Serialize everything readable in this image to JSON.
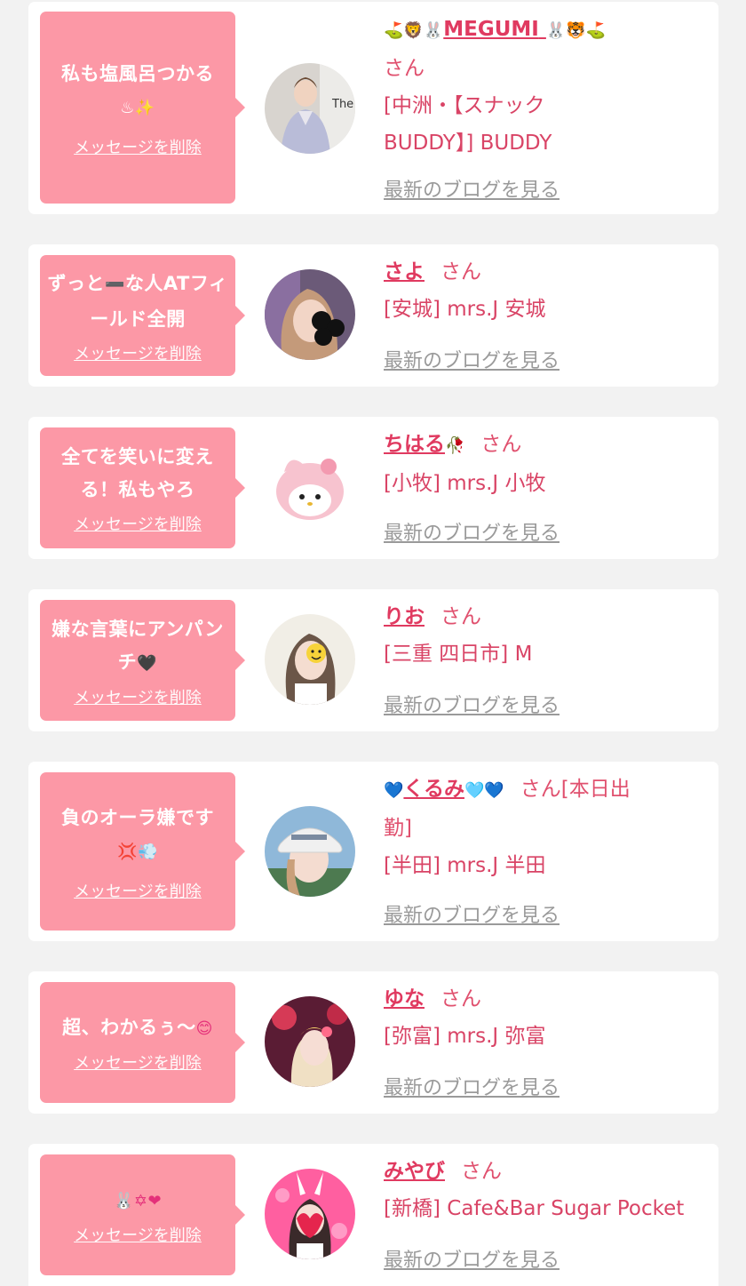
{
  "delete_label": "メッセージを削除",
  "blog_label": "最新のブログを見る",
  "san_label": "さん",
  "cards": [
    {
      "message": "私も塩風呂つかる",
      "message_emoji": "♨✨",
      "name": "MEGUMI",
      "name_prefix_emoji": "🐲🦁🐰",
      "name_suffix_emoji": "🐰🐯🐲",
      "shop_line1": "[中洲・【スナック",
      "shop_line2": "BUDDY】] BUDDY"
    },
    {
      "message": "ずっと",
      "message_mid_emoji": "➖",
      "message_tail": "な人ATフィールド全開",
      "name": "さよ",
      "shop_line1": "[安城] mrs.J 安城"
    },
    {
      "message": "全てを笑いに変える！私もやろ",
      "name": "ちはる",
      "name_suffix_emoji": "🥀",
      "shop_line1": "[小牧] mrs.J 小牧"
    },
    {
      "message": "嫌な言葉にアンパンチ",
      "message_emoji": "🖤",
      "name": "りお",
      "shop_line1": "[三重 四日市] M"
    },
    {
      "message": "負のオーラ嫌です",
      "message_emoji": "💢💨",
      "name": "くるみ",
      "name_prefix_emoji": "💙",
      "name_suffix_emoji": "🩵💙",
      "san_suffix": "[本日出",
      "name_line2": "勤]",
      "shop_line1": "[半田] mrs.J 半田"
    },
    {
      "message": "超、わかるぅ～",
      "message_emoji": "😊",
      "name": "ゆな",
      "shop_line1": "[弥富] mrs.J 弥富"
    },
    {
      "message": "",
      "message_emoji": "🐰✡❤",
      "name": "みやび",
      "shop_line1": "[新橋] Cafe&Bar Sugar Pocket"
    }
  ],
  "colors": {
    "bubble": "#fc98a6",
    "name": "#e03a60",
    "text": "#e05070",
    "blog": "#9a9a9a",
    "background": "#f2f2f2"
  }
}
